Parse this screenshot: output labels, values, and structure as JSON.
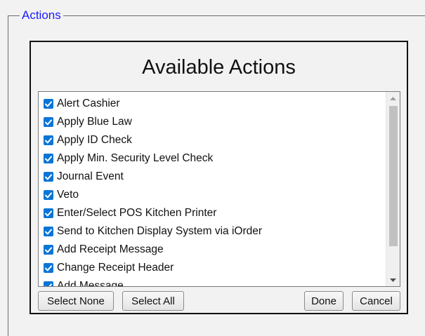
{
  "group": {
    "legend": "Actions"
  },
  "dialog": {
    "title": "Available Actions",
    "items": [
      {
        "label": "Alert Cashier",
        "checked": true
      },
      {
        "label": "Apply Blue Law",
        "checked": true
      },
      {
        "label": "Apply ID Check",
        "checked": true
      },
      {
        "label": "Apply Min. Security Level Check",
        "checked": true
      },
      {
        "label": "Journal Event",
        "checked": true
      },
      {
        "label": "Veto",
        "checked": true
      },
      {
        "label": "Enter/Select POS Kitchen Printer",
        "checked": true
      },
      {
        "label": "Send to Kitchen Display System via iOrder",
        "checked": true
      },
      {
        "label": "Add Receipt Message",
        "checked": true
      },
      {
        "label": "Change Receipt Header",
        "checked": true
      },
      {
        "label": "Add Message",
        "checked": true
      }
    ],
    "buttons": {
      "select_none": "Select None",
      "select_all": "Select All",
      "done": "Done",
      "cancel": "Cancel"
    }
  },
  "colors": {
    "legend": "#1a1aff",
    "checkbox": "#0b75d6"
  }
}
